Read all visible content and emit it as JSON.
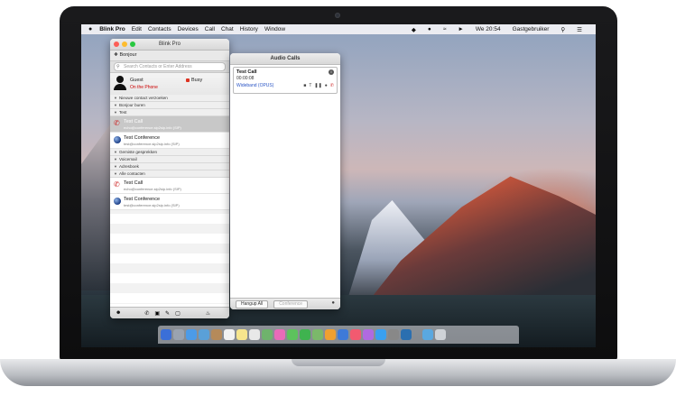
{
  "menubar": {
    "apple": "",
    "app_name": "Blink Pro",
    "items": [
      "Edit",
      "Contacts",
      "Devices",
      "Call",
      "Chat",
      "History",
      "Window"
    ],
    "clock": "We 20:54",
    "user": "Gastgebruiker"
  },
  "blink_window": {
    "title": "Blink Pro",
    "account": "Bonjour",
    "search_placeholder": "Search Contacts or Enter Address",
    "profile": {
      "name": "Guest",
      "status": "On the Phone",
      "presence": "Busy"
    },
    "groups": [
      {
        "label": "Nieuwe contact verzoeken",
        "contacts": []
      },
      {
        "label": "Bonjour buren",
        "contacts": []
      },
      {
        "label": "Test",
        "contacts": [
          {
            "name": "Test Call",
            "uri": "echo@conference.sip2sip.info (SIP)",
            "icon": "phone-icon",
            "selected": true
          },
          {
            "name": "Test Conference",
            "uri": "test@conference.sip2sip.info (SIP)",
            "icon": "globe-icon",
            "selected": false
          }
        ]
      },
      {
        "label": "Gemiste gesprekken",
        "contacts": []
      },
      {
        "label": "Voicemail",
        "contacts": []
      },
      {
        "label": "Adresboek",
        "contacts": []
      },
      {
        "label": "Alle contacten",
        "contacts": [
          {
            "name": "Test Call",
            "uri": "echo@conference.sip2sip.info (SIP)",
            "icon": "phone-icon",
            "selected": false
          },
          {
            "name": "Test Conference",
            "uri": "test@conference.sip2sip.info (SIP)",
            "icon": "globe-icon",
            "selected": false
          }
        ]
      }
    ]
  },
  "audio_window": {
    "title": "Audio Calls",
    "call": {
      "name": "Test Call",
      "duration": "00:00:08",
      "codec": "Wideband (OPUS)"
    },
    "hangup_all": "Hangup All",
    "conference": "Conference"
  },
  "colors": {
    "presence_busy": "#dd3322",
    "codec_link": "#2a55c5",
    "selection": "#c8c8c8"
  }
}
